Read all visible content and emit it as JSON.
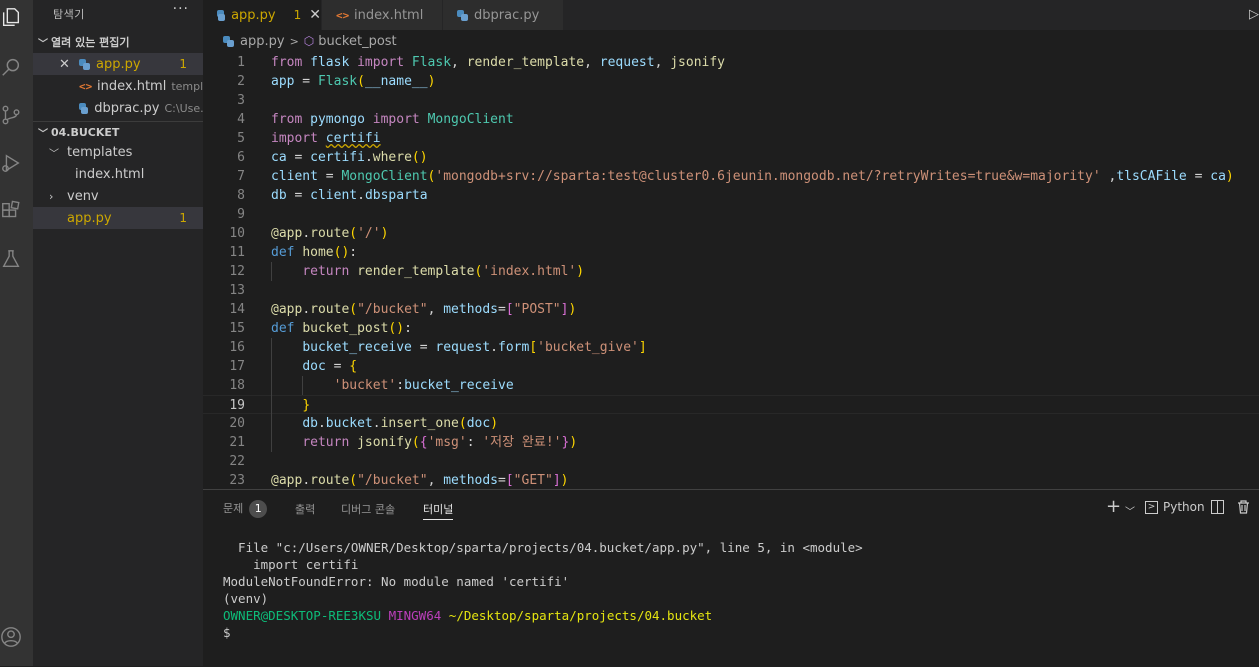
{
  "sidebar": {
    "title": "탐색기",
    "more": "···",
    "open_editors": {
      "label": "열려 있는 편집기",
      "items": [
        {
          "name": "app.py",
          "desc": "",
          "badge": "1"
        },
        {
          "name": "index.html",
          "desc": "templ..."
        },
        {
          "name": "dbprac.py",
          "desc": "C:\\Use..."
        }
      ]
    },
    "workspace": {
      "label": "04.BUCKET",
      "items": [
        {
          "name": "templates"
        },
        {
          "name": "index.html"
        },
        {
          "name": "venv"
        },
        {
          "name": "app.py",
          "badge": "1"
        }
      ]
    }
  },
  "tabs": [
    {
      "label": "app.py",
      "badge": "1",
      "icon": "python-icon"
    },
    {
      "label": "index.html",
      "icon": "html-icon"
    },
    {
      "label": "dbprac.py",
      "icon": "python-icon"
    }
  ],
  "breadcrumb": {
    "file": "app.py",
    "symbol": "bucket_post"
  },
  "editor": {
    "current_line": 19,
    "line_numbers": [
      "1",
      "2",
      "3",
      "4",
      "5",
      "6",
      "7",
      "8",
      "9",
      "10",
      "11",
      "12",
      "13",
      "14",
      "15",
      "16",
      "17",
      "18",
      "19",
      "20",
      "21",
      "22",
      "23"
    ],
    "lines": [
      "from flask import Flask, render_template, request, jsonify",
      "app = Flask(__name__)",
      "",
      "from pymongo import MongoClient",
      "import certifi",
      "ca = certifi.where()",
      "client = MongoClient('mongodb+srv://sparta:test@cluster0.6jeunin.mongodb.net/?retryWrites=true&w=majority' ,tlsCAFile = ca)",
      "db = client.dbsparta",
      "",
      "@app.route('/')",
      "def home():",
      "    return render_template('index.html')",
      "",
      "@app.route(\"/bucket\", methods=[\"POST\"])",
      "def bucket_post():",
      "    bucket_receive = request.form['bucket_give']",
      "    doc = {",
      "        'bucket':bucket_receive",
      "    }",
      "    db.bucket.insert_one(doc)",
      "    return jsonify({'msg': '저장 완료!'})",
      "",
      "@app.route(\"/bucket\", methods=[\"GET\"])"
    ]
  },
  "panel": {
    "tabs": [
      {
        "label": "문제",
        "count": "1"
      },
      {
        "label": "출력"
      },
      {
        "label": "디버그 콘솔"
      },
      {
        "label": "터미널"
      }
    ],
    "shell_label": "Python",
    "terminal": {
      "l1": "  File \"c:/Users/OWNER/Desktop/sparta/projects/04.bucket/app.py\", line 5, in <module>",
      "l2": "    import certifi",
      "l3": "ModuleNotFoundError: No module named 'certifi'",
      "l4": "(venv)",
      "user": "OWNER@DESKTOP-REE3KSU",
      "shell": "MINGW64",
      "path": "~/Desktop/sparta/projects/04.bucket",
      "prompt": "$"
    }
  },
  "colors": {
    "accent_warning": "#cca700",
    "selection": "#37373d",
    "terminal_green": "#0dbc79",
    "terminal_magenta": "#bc3fbc",
    "terminal_yellow": "#e5e510"
  }
}
